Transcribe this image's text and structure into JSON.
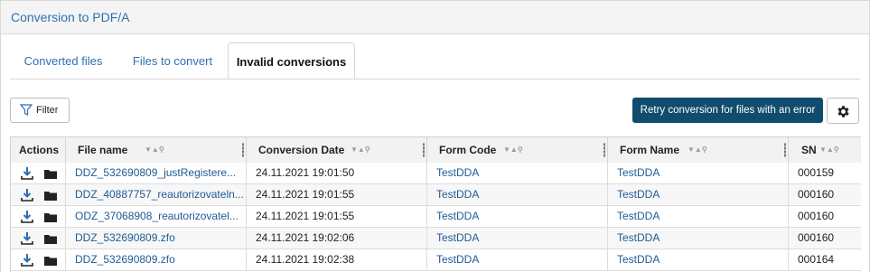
{
  "panel": {
    "title": "Conversion to PDF/A"
  },
  "tabs": [
    {
      "label": "Converted files"
    },
    {
      "label": "Files to convert"
    },
    {
      "label": "Invalid conversions"
    }
  ],
  "toolbar": {
    "filter_label": "Filter",
    "retry_label": "Retry conversion for files with an error",
    "settings_icon": "gear-icon",
    "accent_color": "#0f4c6e"
  },
  "table": {
    "columns": [
      "Actions",
      "File name",
      "Conversion Date",
      "Form Code",
      "Form Name",
      "SN"
    ],
    "rows": [
      {
        "file": "DDZ_532690809_justRegistere...",
        "date": "24.11.2021 19:01:50",
        "code": "TestDDA",
        "name": "TestDDA",
        "sn": "000159"
      },
      {
        "file": "DDZ_40887757_reautorizovateln...",
        "date": "24.11.2021 19:01:55",
        "code": "TestDDA",
        "name": "TestDDA",
        "sn": "000160"
      },
      {
        "file": "ODZ_37068908_reautorizovatel...",
        "date": "24.11.2021 19:01:55",
        "code": "TestDDA",
        "name": "TestDDA",
        "sn": "000160"
      },
      {
        "file": "DDZ_532690809.zfo",
        "date": "24.11.2021 19:02:06",
        "code": "TestDDA",
        "name": "TestDDA",
        "sn": "000160"
      },
      {
        "file": "DDZ_532690809.zfo",
        "date": "24.11.2021 19:02:38",
        "code": "TestDDA",
        "name": "TestDDA",
        "sn": "000164"
      }
    ],
    "link_color": "#1f5a92"
  }
}
